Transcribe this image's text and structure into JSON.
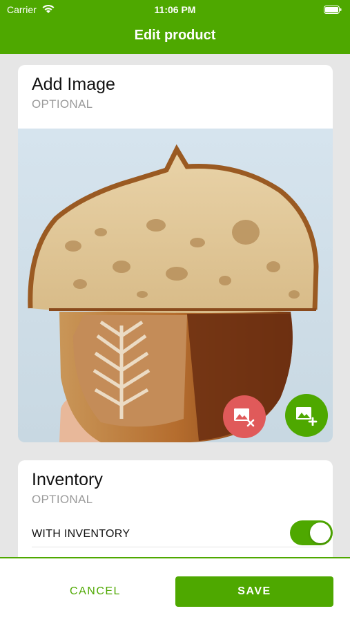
{
  "status_bar": {
    "carrier": "Carrier",
    "time": "11:06 PM"
  },
  "nav": {
    "title": "Edit product"
  },
  "image_card": {
    "title": "Add Image",
    "subtitle": "OPTIONAL",
    "photo_description_icon": "bread-photo",
    "remove_icon": "remove-image-icon",
    "add_icon": "add-image-icon"
  },
  "inventory_card": {
    "title": "Inventory",
    "subtitle": "OPTIONAL",
    "with_inventory_label": "WITH INVENTORY",
    "with_inventory_on": true
  },
  "actions": {
    "cancel_label": "CANCEL",
    "save_label": "SAVE"
  },
  "colors": {
    "brand_green": "#4ea800",
    "remove_red": "#e05a5a"
  }
}
